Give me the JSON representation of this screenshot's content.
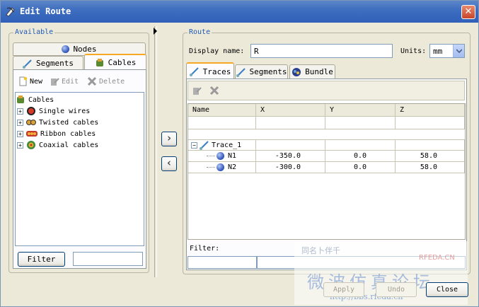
{
  "window": {
    "title": "Edit Route",
    "close_glyph": "✕"
  },
  "available": {
    "title": "Available",
    "tabs": {
      "nodes": "Nodes",
      "segments": "Segments",
      "cables": "Cables"
    },
    "toolbar": {
      "new": "New",
      "edit": "Edit",
      "delete": "Delete"
    },
    "tree": {
      "root": "Cables",
      "children": [
        "Single wires",
        "Twisted cables",
        "Ribbon cables",
        "Coaxial cables"
      ]
    },
    "filter_button": "Filter",
    "filter_value": ""
  },
  "transfer": {
    "add_glyph": "›",
    "remove_glyph": "‹"
  },
  "route": {
    "title": "Route",
    "display_name_label": "Display name:",
    "display_name_value": "R",
    "units_label": "Units:",
    "units_value": "mm",
    "tabs": {
      "traces": "Traces",
      "segments": "Segments",
      "bundle": "Bundle"
    },
    "columns": [
      "Name",
      "X",
      "Y",
      "Z"
    ],
    "trace": {
      "name": "Trace_1",
      "rows": [
        {
          "name": "N1",
          "x": "-350.0",
          "y": "0.0",
          "z": "58.0"
        },
        {
          "name": "N2",
          "x": "-300.0",
          "y": "0.0",
          "z": "58.0"
        }
      ]
    },
    "filter_label": "Filter:"
  },
  "footer": {
    "apply": "Apply",
    "undo": "Undo",
    "close": "Close"
  },
  "watermark": {
    "line1": "同名卜伴千",
    "brand": "RFEDA.CN",
    "big": "微波仿真论坛",
    "url": "http://bbs.rfeda.cn"
  },
  "colors": {
    "title_bar": "#3f6fc0",
    "tab_accent": "#f6a825",
    "group_title": "#2159b5"
  }
}
